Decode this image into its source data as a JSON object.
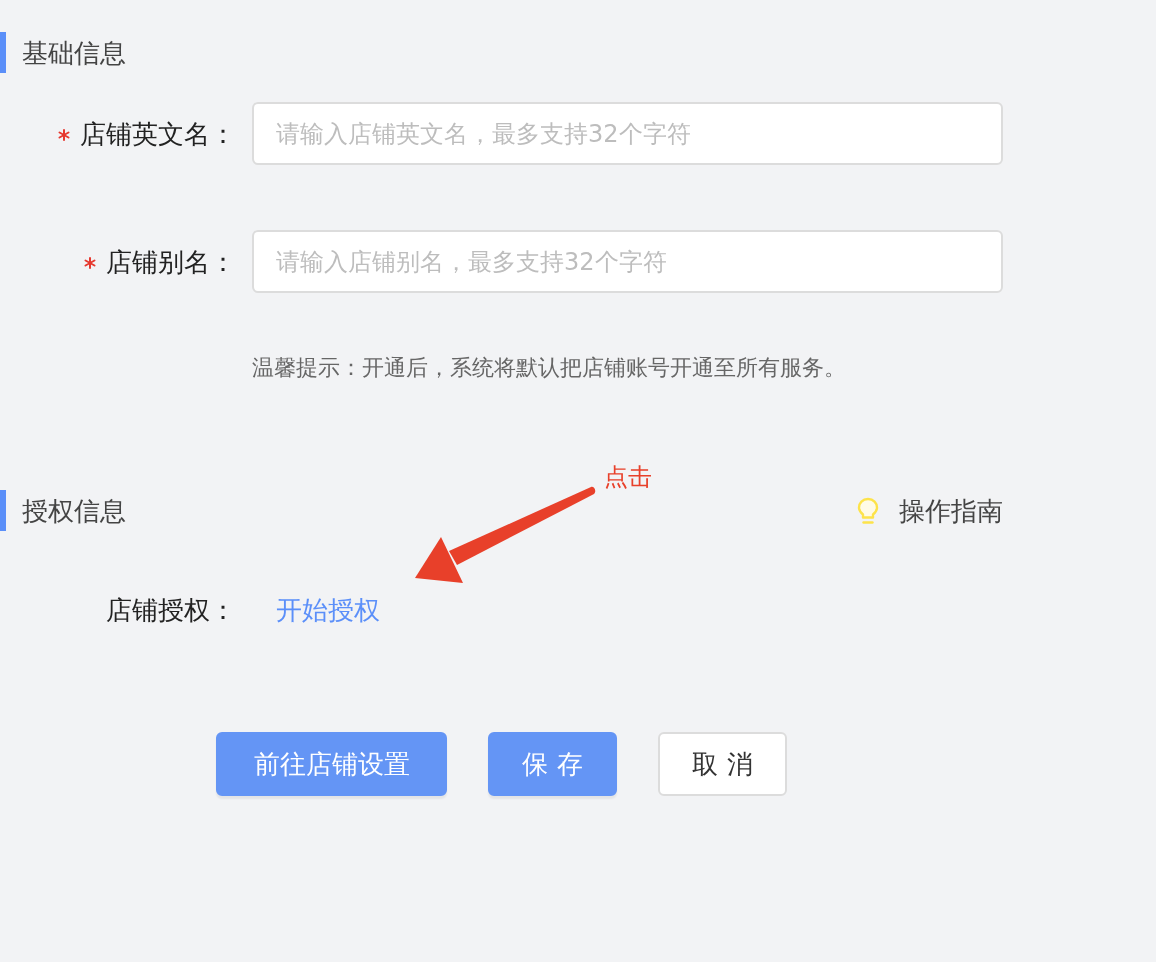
{
  "sections": [
    {
      "title": "基础信息",
      "fields": [
        {
          "kind": "input",
          "label": "店铺英文名：",
          "required": true,
          "placeholder": "请输入店铺英文名，最多支持32个字符"
        },
        {
          "kind": "input",
          "label": "店铺别名：",
          "required": true,
          "placeholder": "请输入店铺别名，最多支持32个字符"
        }
      ],
      "hint": "温馨提示：开通后，系统将默认把店铺账号开通至所有服务。"
    },
    {
      "title": "授权信息",
      "guide_link": "操作指南",
      "fields": [
        {
          "kind": "link",
          "label": "店铺授权：",
          "link": "开始授权"
        }
      ]
    }
  ],
  "annotation": {
    "text": "点击"
  },
  "buttons": [
    {
      "label": "前往店铺设置",
      "kind": "primary"
    },
    {
      "label": "保 存",
      "kind": "primary"
    },
    {
      "label": "取 消",
      "kind": "default"
    }
  ]
}
